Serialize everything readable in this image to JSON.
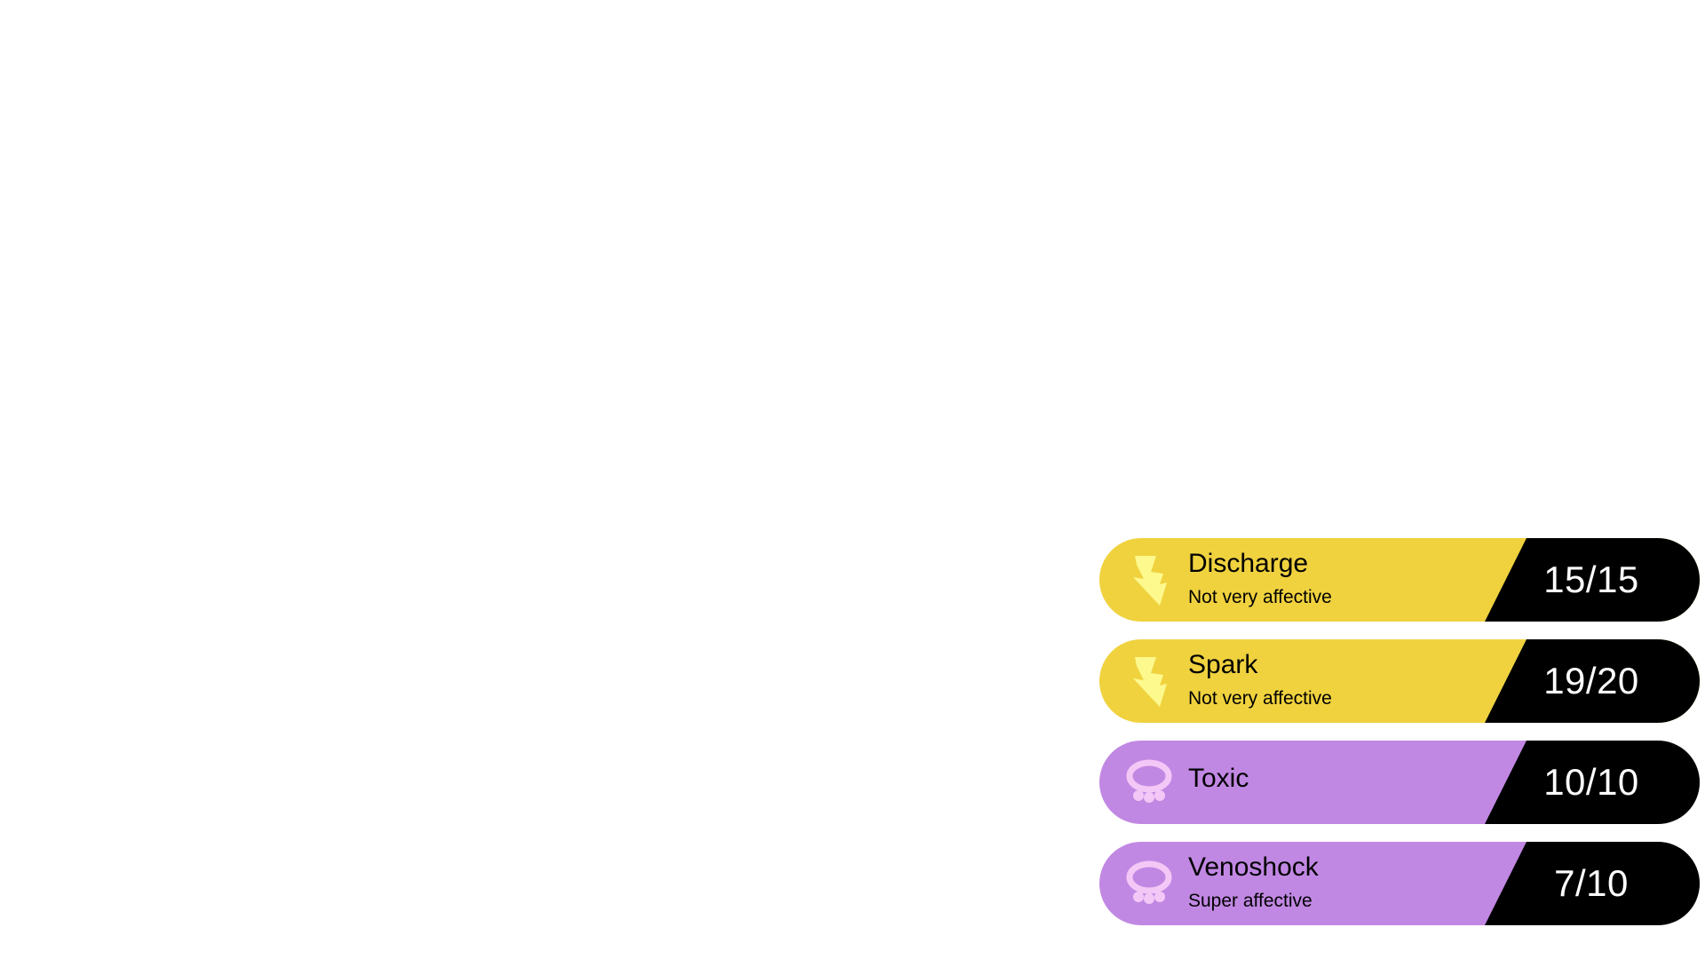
{
  "moves": [
    {
      "name": "Discharge",
      "effectiveness": "Not very affective",
      "pp": "15/15",
      "type_icon": "electric-bolt-icon",
      "bg_color": "#f0d23f",
      "icon_color": "#fdf98d"
    },
    {
      "name": "Spark",
      "effectiveness": "Not very affective",
      "pp": "19/20",
      "type_icon": "electric-bolt-icon",
      "bg_color": "#f0d23f",
      "icon_color": "#fdf98d"
    },
    {
      "name": "Toxic",
      "effectiveness": "",
      "pp": "10/10",
      "type_icon": "poison-skull-icon",
      "bg_color": "#c188e3",
      "icon_color": "#f4c8f6"
    },
    {
      "name": "Venoshock",
      "effectiveness": "Super affective",
      "pp": "7/10",
      "type_icon": "poison-skull-icon",
      "bg_color": "#c188e3",
      "icon_color": "#f4c8f6"
    }
  ]
}
